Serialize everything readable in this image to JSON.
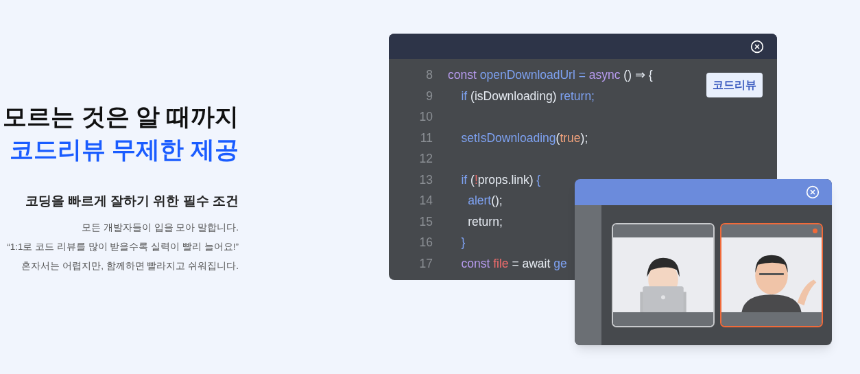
{
  "hero": {
    "title": "모르는 것은 알 때까지",
    "highlight": "코드리뷰 무제한 제공",
    "subtitle": "코딩을 빠르게 잘하기 위한 필수 조건",
    "paragraphs": [
      "모든 개발자들이 입을 모아 말합니다.",
      "“1:1로 코드 리뷰를 많이 받을수록 실력이 빨리 늘어요!”",
      "혼자서는 어렵지만, 함께하면 빨라지고 쉬워집니다."
    ]
  },
  "code_window": {
    "badge": "코드리뷰",
    "lines": [
      {
        "number": "8",
        "tokens": [
          {
            "text": "const ",
            "kind": "keyword"
          },
          {
            "text": "openDownloadUrl",
            "kind": "function"
          },
          {
            "text": " = ",
            "kind": "function"
          },
          {
            "text": "async ",
            "kind": "keyword"
          },
          {
            "text": "() ⇒ {",
            "kind": "plain"
          }
        ]
      },
      {
        "number": "9",
        "tokens": [
          {
            "text": "    if ",
            "kind": "function"
          },
          {
            "text": "(isDownloading) ",
            "kind": "plain"
          },
          {
            "text": "return;",
            "kind": "function"
          }
        ]
      },
      {
        "number": "10"
      },
      {
        "number": "11",
        "tokens": [
          {
            "text": "    setIsDownloading",
            "kind": "function"
          },
          {
            "text": "(",
            "kind": "plain"
          },
          {
            "text": "true",
            "kind": "literal"
          },
          {
            "text": ");",
            "kind": "plain"
          }
        ]
      },
      {
        "number": "12"
      },
      {
        "number": "13",
        "tokens": [
          {
            "text": "    if ",
            "kind": "function"
          },
          {
            "text": "(",
            "kind": "plain"
          },
          {
            "text": "!",
            "kind": "variable"
          },
          {
            "text": "props.link) ",
            "kind": "plain"
          },
          {
            "text": "{",
            "kind": "function"
          }
        ]
      },
      {
        "number": "14",
        "tokens": [
          {
            "text": "      alert",
            "kind": "function"
          },
          {
            "text": "();",
            "kind": "plain"
          }
        ]
      },
      {
        "number": "15",
        "tokens": [
          {
            "text": "      return;",
            "kind": "plain"
          }
        ]
      },
      {
        "number": "16",
        "tokens": [
          {
            "text": "    }",
            "kind": "function"
          }
        ]
      },
      {
        "number": "17",
        "tokens": [
          {
            "text": "    const ",
            "kind": "keyword"
          },
          {
            "text": "file",
            "kind": "variable"
          },
          {
            "text": " = ",
            "kind": "plain"
          },
          {
            "text": "await ",
            "kind": "plain"
          },
          {
            "text": "ge",
            "kind": "function"
          }
        ]
      }
    ]
  },
  "video_window": {
    "tiles": [
      {
        "kind": "picture",
        "selected": false,
        "speaking": false
      },
      {
        "kind": "picture",
        "selected": true,
        "speaking": true
      }
    ]
  }
}
